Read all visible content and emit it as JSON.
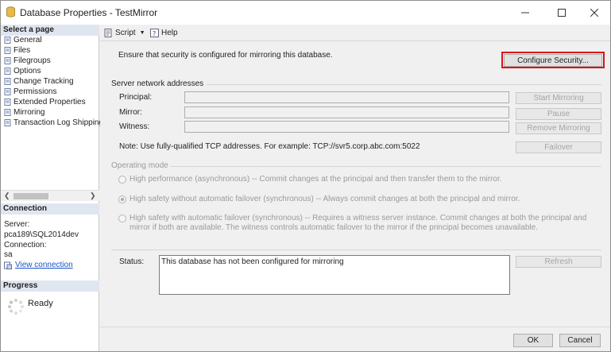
{
  "window": {
    "title": "Database Properties - TestMirror"
  },
  "left_panel": {
    "select_page_header": "Select a page",
    "pages": [
      "General",
      "Files",
      "Filegroups",
      "Options",
      "Change Tracking",
      "Permissions",
      "Extended Properties",
      "Mirroring",
      "Transaction Log Shipping"
    ],
    "connection_header": "Connection",
    "server_label": "Server:",
    "server_value": "pca189\\SQL2014dev",
    "connection_label": "Connection:",
    "connection_value": "sa",
    "view_connection_link": "View connection",
    "progress_header": "Progress",
    "progress_status": "Ready"
  },
  "toolbar": {
    "script_label": "Script",
    "help_label": "Help"
  },
  "mirroring": {
    "security_text": "Ensure that security is configured for mirroring this database.",
    "configure_security_button": "Configure Security...",
    "server_network_header": "Server network addresses",
    "principal_label": "Principal:",
    "mirror_label": "Mirror:",
    "witness_label": "Witness:",
    "principal_value": "",
    "mirror_value": "",
    "witness_value": "",
    "start_mirroring_button": "Start Mirroring",
    "pause_button": "Pause",
    "remove_mirroring_button": "Remove Mirroring",
    "failover_button": "Failover",
    "note_text": "Note: Use fully-qualified TCP addresses. For example: TCP://svr5.corp.abc.com:5022",
    "operating_mode_header": "Operating mode",
    "mode_high_performance": "High performance (asynchronous) -- Commit changes at the principal and then transfer them to the mirror.",
    "mode_high_safety_no_failover": "High safety without automatic failover (synchronous) -- Always commit changes at both the principal and mirror.",
    "mode_high_safety_failover_line1": "High safety with automatic failover (synchronous) -- Requires a witness server instance. Commit changes at both the principal and",
    "mode_high_safety_failover_line2": "mirror if both are available. The witness controls automatic failover to the mirror if the principal becomes unavailable.",
    "selected_mode": "High safety without automatic failover (synchronous)",
    "status_label": "Status:",
    "status_value": "This database has not been configured for mirroring",
    "refresh_button": "Refresh"
  },
  "footer": {
    "ok_button": "OK",
    "cancel_button": "Cancel"
  },
  "colors": {
    "highlight": "#d8141a",
    "link": "#1a54c4",
    "section_header": "#dfe6f0"
  }
}
